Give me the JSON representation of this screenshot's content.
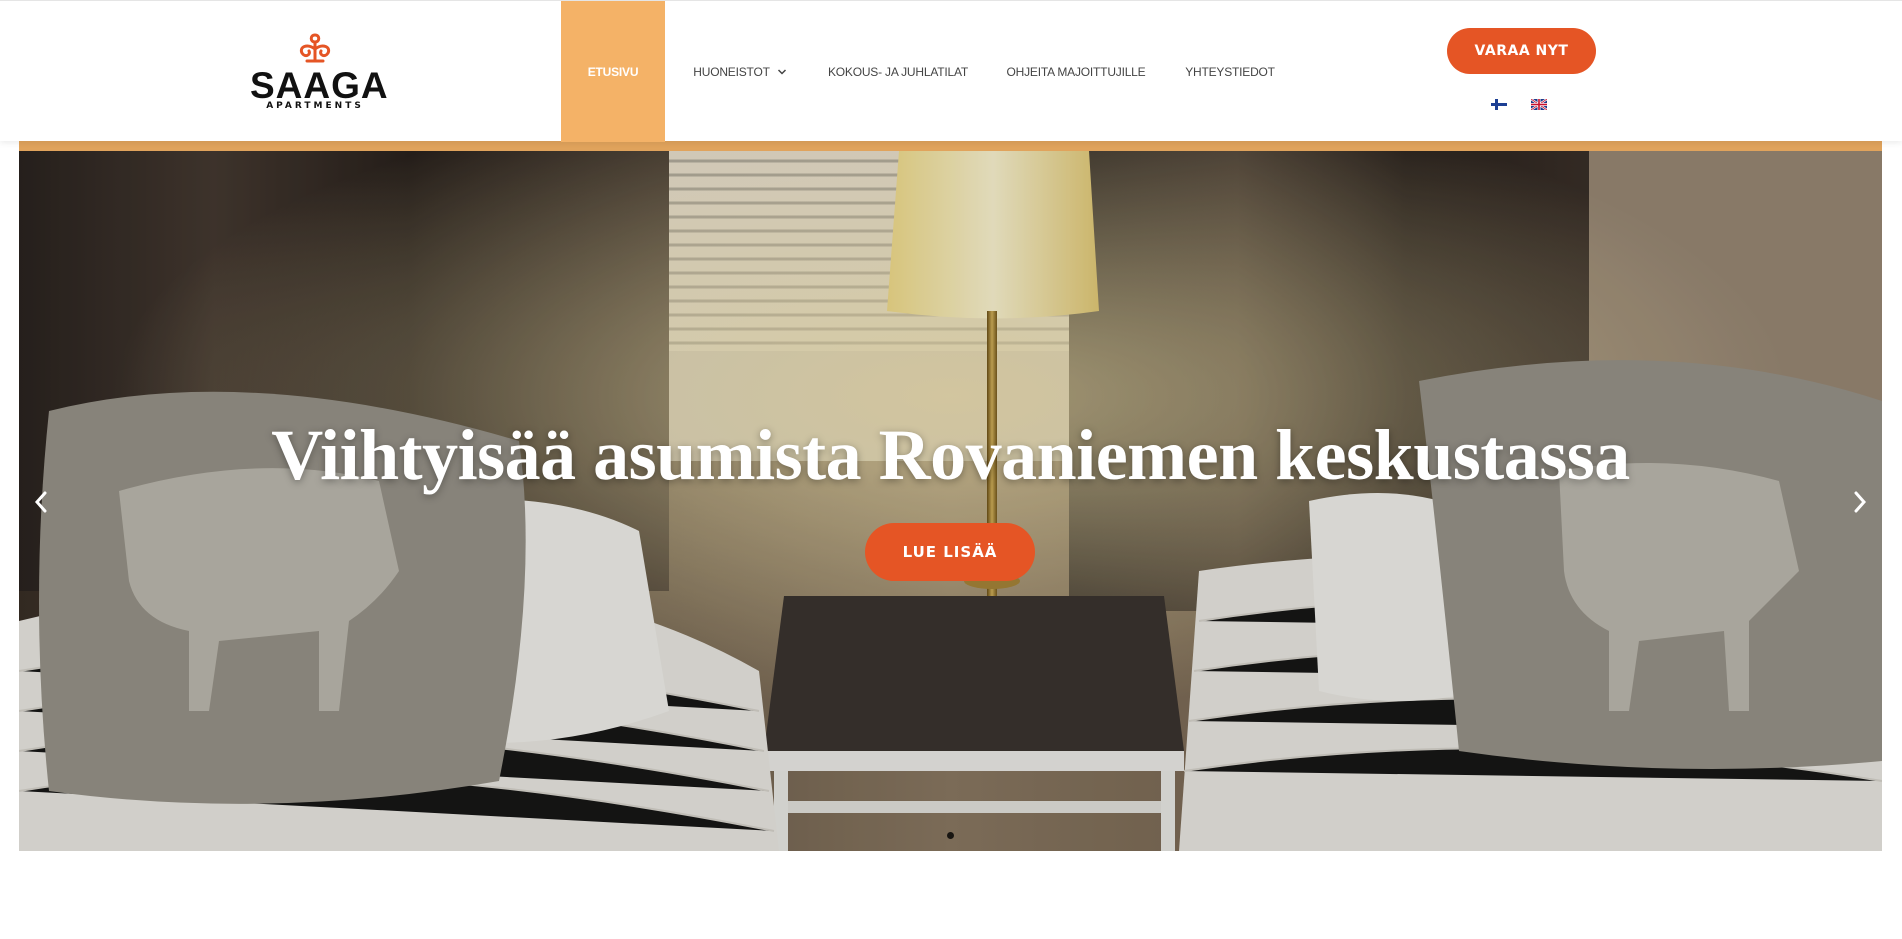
{
  "brand": {
    "name": "SAAGA",
    "subtitle": "APARTMENTS",
    "accent_color": "#e55525",
    "highlight_color": "#f4b267"
  },
  "nav": {
    "items": [
      {
        "label": "ETUSIVU",
        "active": true,
        "has_dropdown": false
      },
      {
        "label": "HUONEISTOT",
        "active": false,
        "has_dropdown": true
      },
      {
        "label": "KOKOUS- JA JUHLATILAT",
        "active": false,
        "has_dropdown": false
      },
      {
        "label": "OHJEITA MAJOITTUJILLE",
        "active": false,
        "has_dropdown": false
      },
      {
        "label": "YHTEYSTIEDOT",
        "active": false,
        "has_dropdown": false
      }
    ]
  },
  "header_cta": {
    "label": "VARAA NYT"
  },
  "languages": [
    {
      "icon": "finland-flag-icon"
    },
    {
      "icon": "uk-flag-icon"
    }
  ],
  "hero": {
    "title": "Viihtyisää asumista Rovaniemen keskustassa",
    "button_label": "LUE LISÄÄ",
    "slides": 1,
    "active_slide": 1,
    "prev_icon": "chevron-left-icon",
    "next_icon": "chevron-right-icon"
  }
}
